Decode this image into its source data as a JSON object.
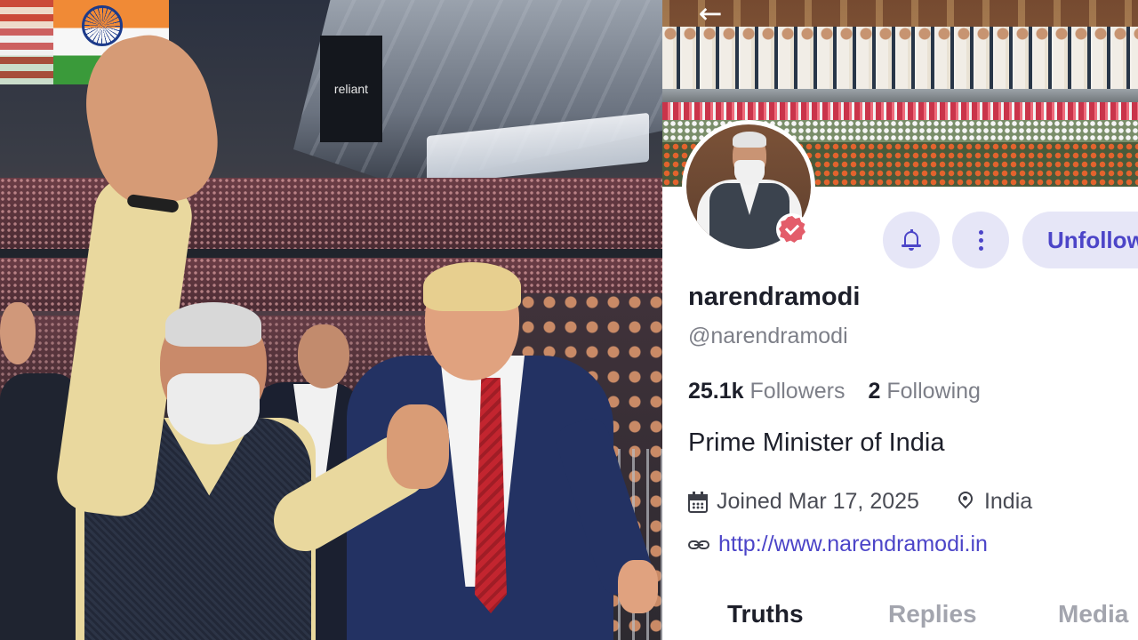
{
  "photo": {
    "scoreboard_text": "reliant"
  },
  "profile": {
    "back_glyph": "←",
    "display_name": "narendramodi",
    "handle": "@narendramodi",
    "followers_count": "25.1k",
    "followers_label": "Followers",
    "following_count": "2",
    "following_label": "Following",
    "bio": "Prime Minister of India",
    "joined": "Joined Mar 17, 2025",
    "location": "India",
    "website": "http://www.narendramodi.in",
    "unfollow_label": "Unfollow",
    "tabs": [
      "Truths",
      "Replies",
      "Media"
    ],
    "active_tab": "Truths",
    "verified_color": "#e35d6a",
    "accent_color": "#4c45c8",
    "icons": {
      "back": "arrow-left-icon",
      "notify": "bell-icon",
      "more": "more-vertical-icon",
      "joined": "calendar-icon",
      "location": "map-pin-icon",
      "website": "link-icon",
      "verified": "verified-badge-icon"
    }
  }
}
